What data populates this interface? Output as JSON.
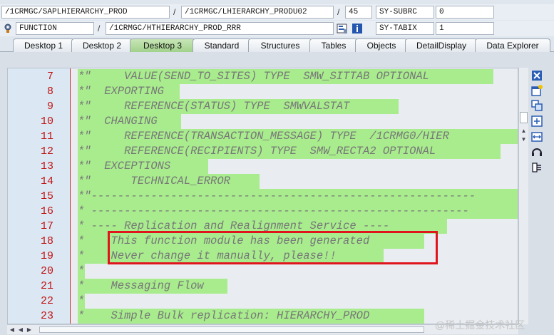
{
  "header": {
    "row1": {
      "program": "/1CRMGC/SAPLHIERARCHY_PROD",
      "separator": "/",
      "include": "/1CRMGC/LHIERARCHY_PRODU02",
      "line": "45",
      "var_name": "SY-SUBRC",
      "var_value": "0"
    },
    "row2": {
      "event_type": "FUNCTION",
      "separator": "/",
      "event_name": "/1CRMGC/HTHIERARCHY_PROD_RRR",
      "var_name": "SY-TABIX",
      "var_value": "1"
    }
  },
  "tabs": [
    {
      "label": "Desktop 1"
    },
    {
      "label": "Desktop 2"
    },
    {
      "label": "Desktop 3"
    },
    {
      "label": "Standard"
    },
    {
      "label": "Structures"
    },
    {
      "label": "Tables"
    },
    {
      "label": "Objects"
    },
    {
      "label": "DetailDisplay"
    },
    {
      "label": "Data Explorer"
    }
  ],
  "active_tab": "Desktop 3",
  "colors": {
    "code_highlight": "#a8ec8e",
    "line_number": "#c11414",
    "annotation_box": "#e0141c"
  },
  "code_lines": [
    {
      "num": "7",
      "text": "*\"     VALUE(SEND_TO_SITES) TYPE  SMW_SITTAB OPTIONAL"
    },
    {
      "num": "8",
      "text": "*\"  EXPORTING"
    },
    {
      "num": "9",
      "text": "*\"     REFERENCE(STATUS) TYPE  SMWVALSTAT"
    },
    {
      "num": "10",
      "text": "*\"  CHANGING"
    },
    {
      "num": "11",
      "text": "*\"     REFERENCE(TRANSACTION_MESSAGE) TYPE  /1CRMG0/HIER"
    },
    {
      "num": "12",
      "text": "*\"     REFERENCE(RECIPIENTS) TYPE  SMW_RECTA2 OPTIONAL"
    },
    {
      "num": "13",
      "text": "*\"  EXCEPTIONS"
    },
    {
      "num": "14",
      "text": "*\"      TECHNICAL_ERROR"
    },
    {
      "num": "15",
      "text": "*\"----------------------------------------------------------"
    },
    {
      "num": "16",
      "text": "* ---------------------------------------------------------"
    },
    {
      "num": "17",
      "text": "* ---- Replication and Realignment Service ----"
    },
    {
      "num": "18",
      "text": "*    This function module has been generated"
    },
    {
      "num": "19",
      "text": "*    Never change it manually, please!!"
    },
    {
      "num": "20",
      "text": "*"
    },
    {
      "num": "21",
      "text": "*    Messaging Flow"
    },
    {
      "num": "22",
      "text": "*"
    },
    {
      "num": "23",
      "text": "*    Simple Bulk replication: HIERARCHY_PROD"
    }
  ],
  "watermark": "@稀土掘金技术社区",
  "icons": {
    "event_icon": "function-module-icon",
    "nav_icon": "display-source-icon",
    "info_icon": "info-icon",
    "toolbar": [
      "close-icon",
      "new-window-icon",
      "copy-icon",
      "maximize-icon",
      "swap-horizontal-icon",
      "headset-icon",
      "settings-tool-icon"
    ]
  }
}
